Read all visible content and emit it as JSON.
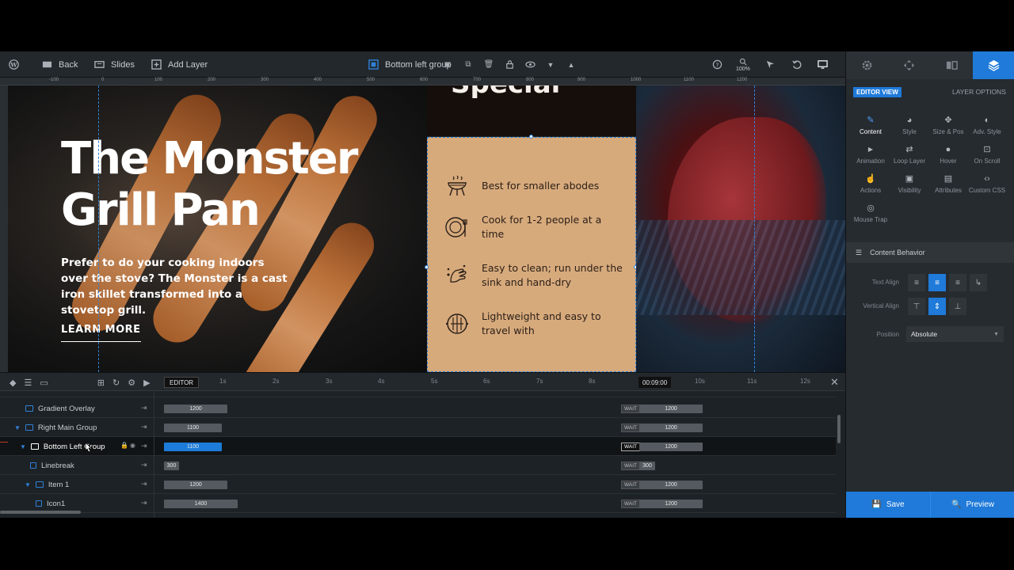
{
  "toolbar": {
    "back": "Back",
    "slides": "Slides",
    "add_layer": "Add Layer",
    "layer_name": "Bottom left group",
    "zoom": "100%"
  },
  "ruler": [
    "-100",
    "0",
    "100",
    "200",
    "300",
    "400",
    "500",
    "600",
    "700",
    "800",
    "900",
    "1000",
    "1100",
    "1200"
  ],
  "canvas": {
    "title": "The Monster Grill Pan",
    "title_line1": "The Monster",
    "title_line2": "Grill Pan",
    "paragraph": "Prefer to do your cooking indoors over the stove? The Monster is a cast iron skillet transformed into a stovetop grill.",
    "cta": "LEARN MORE",
    "mid_heading": "Special",
    "features": [
      {
        "icon": "grill-icon",
        "text": "Best for smaller abodes"
      },
      {
        "icon": "plate-cutlery-icon",
        "text": "Cook for 1-2 people at a time"
      },
      {
        "icon": "clean-hand-icon",
        "text": "Easy to clean; run under the sink and hand-dry"
      },
      {
        "icon": "grill-pan-icon",
        "text": "Lightweight and easy to travel with"
      }
    ]
  },
  "timeline": {
    "editor": "EDITOR",
    "seconds": [
      "1s",
      "2s",
      "3s",
      "4s",
      "5s",
      "6s",
      "7s",
      "8s",
      "9s",
      "10s",
      "11s",
      "12s"
    ],
    "now": "00:09:00",
    "rows": [
      {
        "name": "Gradient Overlay",
        "bar": "1200",
        "wait": "WAIT",
        "end": "1200"
      },
      {
        "name": "Right Main Group",
        "bar": "1100",
        "wait": "WAIT",
        "end": "1200"
      },
      {
        "name": "Bottom Left Group",
        "bar": "1100",
        "wait": "WAIT",
        "end": "1200"
      },
      {
        "name": "Linebreak",
        "bar": "300",
        "wait": "WAIT",
        "end": "300"
      },
      {
        "name": "Item 1",
        "bar": "1200",
        "wait": "WAIT",
        "end": "1200"
      },
      {
        "name": "Icon1",
        "bar": "1400",
        "wait": "WAIT",
        "end": "1200"
      }
    ]
  },
  "panel": {
    "editor_view": "EDITOR VIEW",
    "layer_options": "LAYER OPTIONS",
    "options": [
      "Content",
      "Style",
      "Size & Pos",
      "Adv. Style",
      "Animation",
      "Loop Layer",
      "Hover",
      "On Scroll",
      "Actions",
      "Visibility",
      "Attributes",
      "Custom CSS",
      "Mouse Trap"
    ],
    "content_behavior": "Content Behavior",
    "text_align": "Text Align",
    "vertical_align": "Vertical Align",
    "position_label": "Position",
    "position_value": "Absolute",
    "save": "Save",
    "preview": "Preview"
  },
  "colors": {
    "accent": "#1f7ad9",
    "card": "#d7aa7c"
  }
}
